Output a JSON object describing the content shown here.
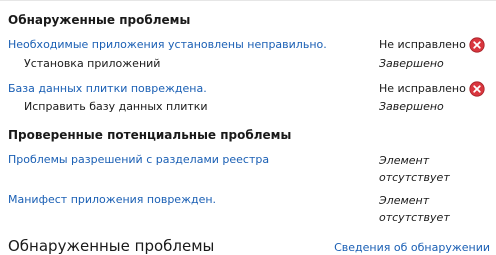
{
  "found_section": {
    "title": "Обнаруженные проблемы",
    "items": [
      {
        "link": "Необходимые приложения установлены неправильно.",
        "status": "Не исправлено",
        "sub_label": "Установка приложений",
        "sub_status": "Завершено"
      },
      {
        "link": "База данных плитки повреждена.",
        "status": "Не исправлено",
        "sub_label": "Исправить базу данных плитки",
        "sub_status": "Завершено"
      }
    ]
  },
  "checked_section": {
    "title": "Проверенные потенциальные проблемы",
    "items": [
      {
        "link": "Проблемы разрешений с разделами реестра",
        "status": "Элемент отсутствует"
      },
      {
        "link": "Манифест приложения поврежден.",
        "status": "Элемент отсутствует"
      }
    ]
  },
  "footer": {
    "title": "Обнаруженные проблемы",
    "details_link": "Сведения об обнаружении"
  },
  "icons": {
    "error": "error-x-icon"
  },
  "colors": {
    "link": "#1a5fb4",
    "error_red": "#d9363e"
  }
}
